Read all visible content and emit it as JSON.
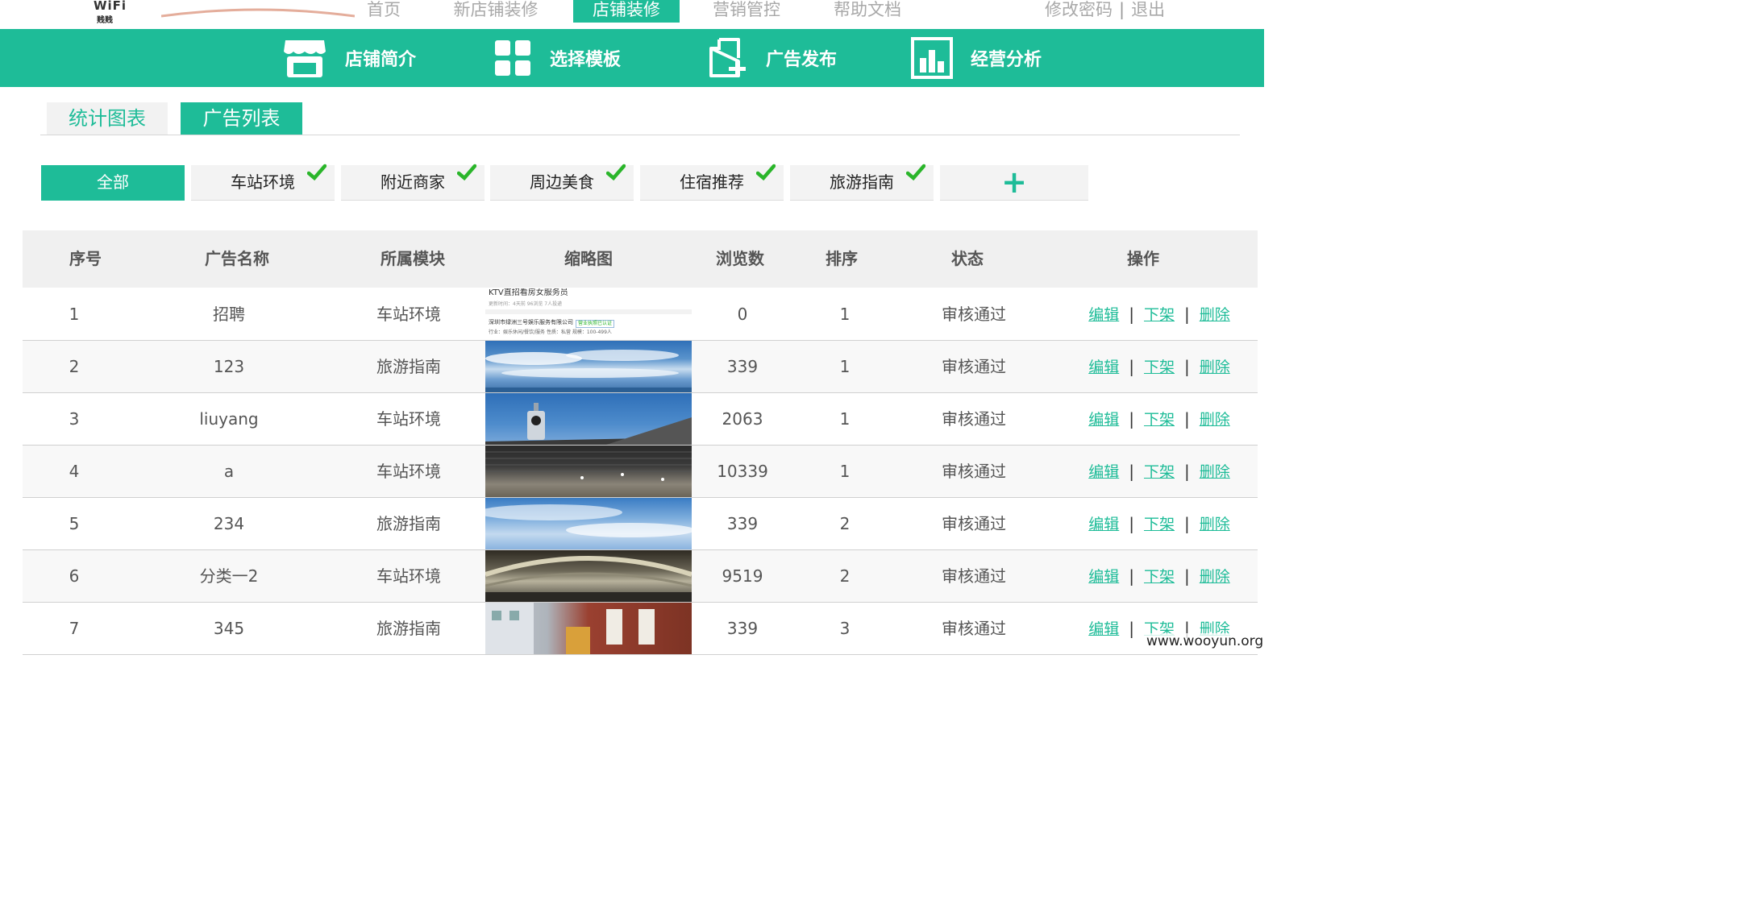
{
  "logo": {
    "text": "WiFi",
    "sub": "贱贱"
  },
  "topnav": {
    "items": [
      "首页",
      "新店铺装修",
      "店铺装修",
      "营销管控",
      "帮助文档"
    ],
    "active_index": 2,
    "change_password": "修改密码",
    "separator": "|",
    "logout": "退出"
  },
  "greenbar": {
    "items": [
      {
        "label": "店铺简介",
        "icon": "store-icon"
      },
      {
        "label": "选择模板",
        "icon": "grid-icon"
      },
      {
        "label": "广告发布",
        "icon": "add-document-icon"
      },
      {
        "label": "经营分析",
        "icon": "bar-chart-icon"
      }
    ]
  },
  "tabs": {
    "stats": "统计图表",
    "ads": "广告列表"
  },
  "categories": {
    "all": "全部",
    "items": [
      "车站环境",
      "附近商家",
      "周边美食",
      "住宿推荐",
      "旅游指南"
    ],
    "add_symbol": "+"
  },
  "table": {
    "headers": [
      "序号",
      "广告名称",
      "所属模块",
      "缩略图",
      "浏览数",
      "排序",
      "状态",
      "操作"
    ],
    "rows": [
      {
        "no": "1",
        "name": "招聘",
        "module": "车站环境",
        "views": "0",
        "order": "1",
        "status": "审核通过",
        "thumb": "recruit-doc"
      },
      {
        "no": "2",
        "name": "123",
        "module": "旅游指南",
        "views": "339",
        "order": "1",
        "status": "审核通过",
        "thumb": "sky"
      },
      {
        "no": "3",
        "name": "liuyang",
        "module": "车站环境",
        "views": "2063",
        "order": "1",
        "status": "审核通过",
        "thumb": "clock-tower"
      },
      {
        "no": "4",
        "name": "a",
        "module": "车站环境",
        "views": "10339",
        "order": "1",
        "status": "审核通过",
        "thumb": "ceiling"
      },
      {
        "no": "5",
        "name": "234",
        "module": "旅游指南",
        "views": "339",
        "order": "2",
        "status": "审核通过",
        "thumb": "sky"
      },
      {
        "no": "6",
        "name": "分类一2",
        "module": "车站环境",
        "views": "9519",
        "order": "2",
        "status": "审核通过",
        "thumb": "station-hall"
      },
      {
        "no": "7",
        "name": "345",
        "module": "旅游指南",
        "views": "339",
        "order": "3",
        "status": "审核通过",
        "thumb": "brick-building"
      }
    ],
    "actions": {
      "edit": "编辑",
      "offshelf": "下架",
      "delete": "删除",
      "sep": "|"
    }
  },
  "thumb_recruit": {
    "title": "KTV直招看房女服务员",
    "meta": "更新时间：4天前    96浏览    7人投递",
    "company": "深圳市绿洲三号娱乐服务有限公司",
    "license": "营业执照已认证",
    "detail": "行业：娱乐休闲/餐饮/服务    性质：私营    规模：100-499人"
  },
  "watermark": "www.wooyun.org",
  "colors": {
    "accent": "#1ebc98",
    "checkmark": "#2ab52a"
  }
}
